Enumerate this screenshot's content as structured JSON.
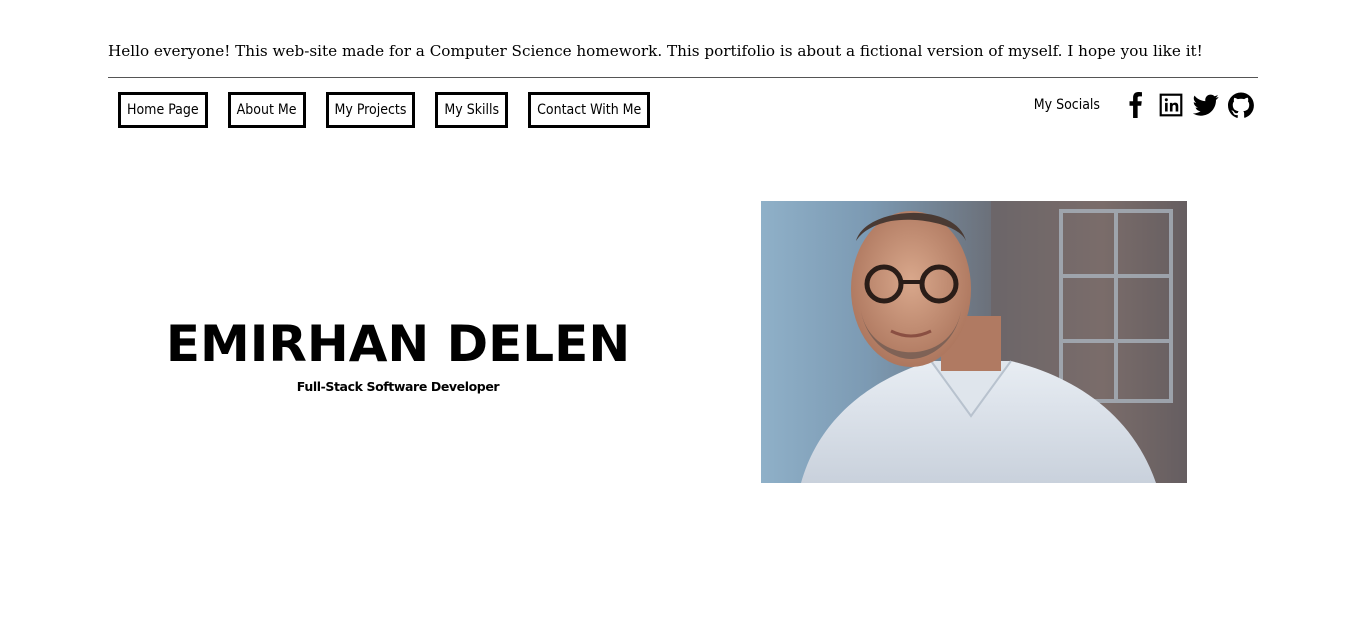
{
  "intro_text": "Hello everyone! This web-site made for a Computer Science homework. This portifolio is about a fictional version of myself. I hope you like it!",
  "nav": {
    "items": [
      {
        "label": "Home Page"
      },
      {
        "label": "About Me"
      },
      {
        "label": "My Projects"
      },
      {
        "label": "My Skills"
      },
      {
        "label": "Contact With Me"
      }
    ]
  },
  "socials": {
    "label": "My Socials",
    "icons": [
      "facebook-icon",
      "linkedin-icon",
      "twitter-icon",
      "github-icon"
    ]
  },
  "hero": {
    "name": "EMIRHAN DELEN",
    "subtitle": "Full-Stack Software Developer"
  }
}
